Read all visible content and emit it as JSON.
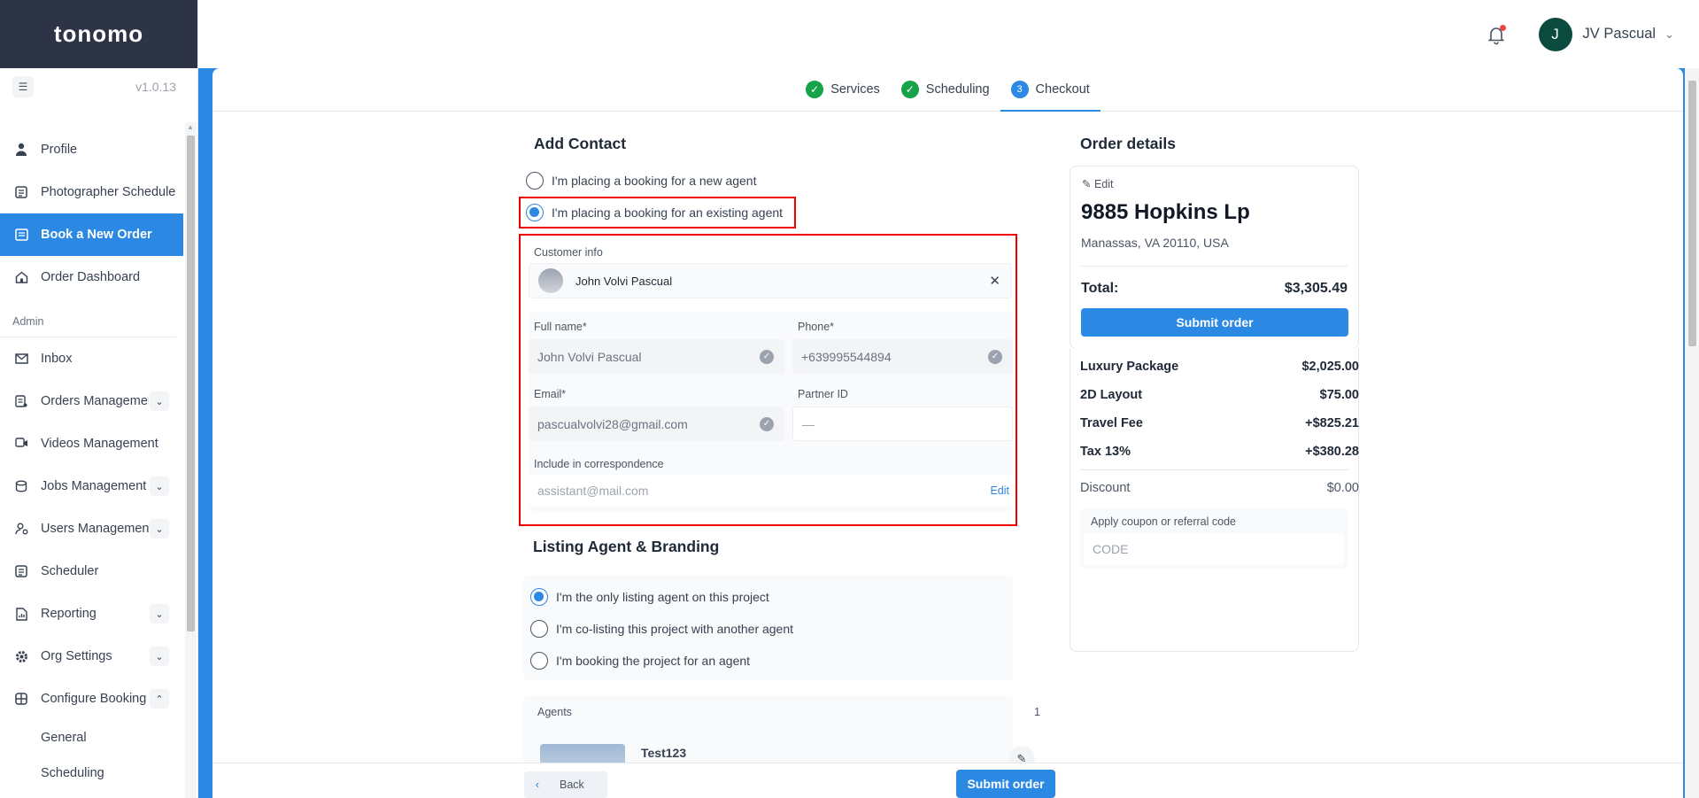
{
  "brand": "tonomo",
  "version": "v1.0.13",
  "user": {
    "initial": "J",
    "name": "JV Pascual"
  },
  "sidebar": {
    "items": [
      {
        "label": "Profile",
        "icon": "user-icon"
      },
      {
        "label": "Photographer Schedule",
        "icon": "calendar-list-icon"
      },
      {
        "label": "Book a New Order",
        "icon": "book-order-icon"
      },
      {
        "label": "Order Dashboard",
        "icon": "home-icon"
      }
    ],
    "admin_label": "Admin",
    "admin_items": [
      {
        "label": "Inbox",
        "icon": "mail-icon"
      },
      {
        "label": "Orders Management",
        "icon": "orders-icon"
      },
      {
        "label": "Videos Management",
        "icon": "video-icon"
      },
      {
        "label": "Jobs Management",
        "icon": "jobs-icon"
      },
      {
        "label": "Users Management",
        "icon": "users-icon"
      },
      {
        "label": "Scheduler",
        "icon": "scheduler-icon"
      },
      {
        "label": "Reporting",
        "icon": "report-icon"
      },
      {
        "label": "Org Settings",
        "icon": "gear-icon"
      },
      {
        "label": "Configure Booking",
        "icon": "grid-icon"
      }
    ],
    "sub_items": [
      "General",
      "Scheduling"
    ]
  },
  "steps": [
    {
      "label": "Services"
    },
    {
      "label": "Scheduling"
    },
    {
      "num": "3",
      "label": "Checkout"
    }
  ],
  "contact": {
    "title": "Add Contact",
    "opt_new": "I'm placing a booking for a new agent",
    "opt_existing": "I'm placing a booking for an existing agent",
    "customer_info_label": "Customer info",
    "customer_name": "John Volvi Pascual",
    "full_name_label": "Full name*",
    "full_name": "John Volvi Pascual",
    "phone_label": "Phone*",
    "phone": "+639995544894",
    "email_label": "Email*",
    "email": "pascualvolvi28@gmail.com",
    "partner_label": "Partner ID",
    "partner": "—",
    "corr_label": "Include in correspondence",
    "corr_placeholder": "assistant@mail.com",
    "edit": "Edit"
  },
  "listing": {
    "title": "Listing Agent & Branding",
    "opt1": "I'm the only listing agent on this project",
    "opt2": "I'm co-listing this project with another agent",
    "opt3": "I'm booking the project for an agent",
    "agents_label": "Agents",
    "agents_count": "1",
    "agent_name": "Test123"
  },
  "order": {
    "title": "Order details",
    "edit": "Edit",
    "address": "9885 Hopkins Lp",
    "city": "Manassas, VA 20110, USA",
    "total_label": "Total:",
    "total": "$3,305.49",
    "submit": "Submit order",
    "lines": [
      {
        "label": "Luxury Package",
        "value": "$2,025.00"
      },
      {
        "label": "2D Layout",
        "value": "$75.00"
      },
      {
        "label": "Travel Fee",
        "value": "+$825.21"
      },
      {
        "label": "Tax 13%",
        "value": "+$380.28"
      }
    ],
    "discount_label": "Discount",
    "discount": "$0.00",
    "coupon_label": "Apply coupon or referral code",
    "coupon_placeholder": "CODE"
  },
  "footer": {
    "back": "Back",
    "submit": "Submit order"
  }
}
